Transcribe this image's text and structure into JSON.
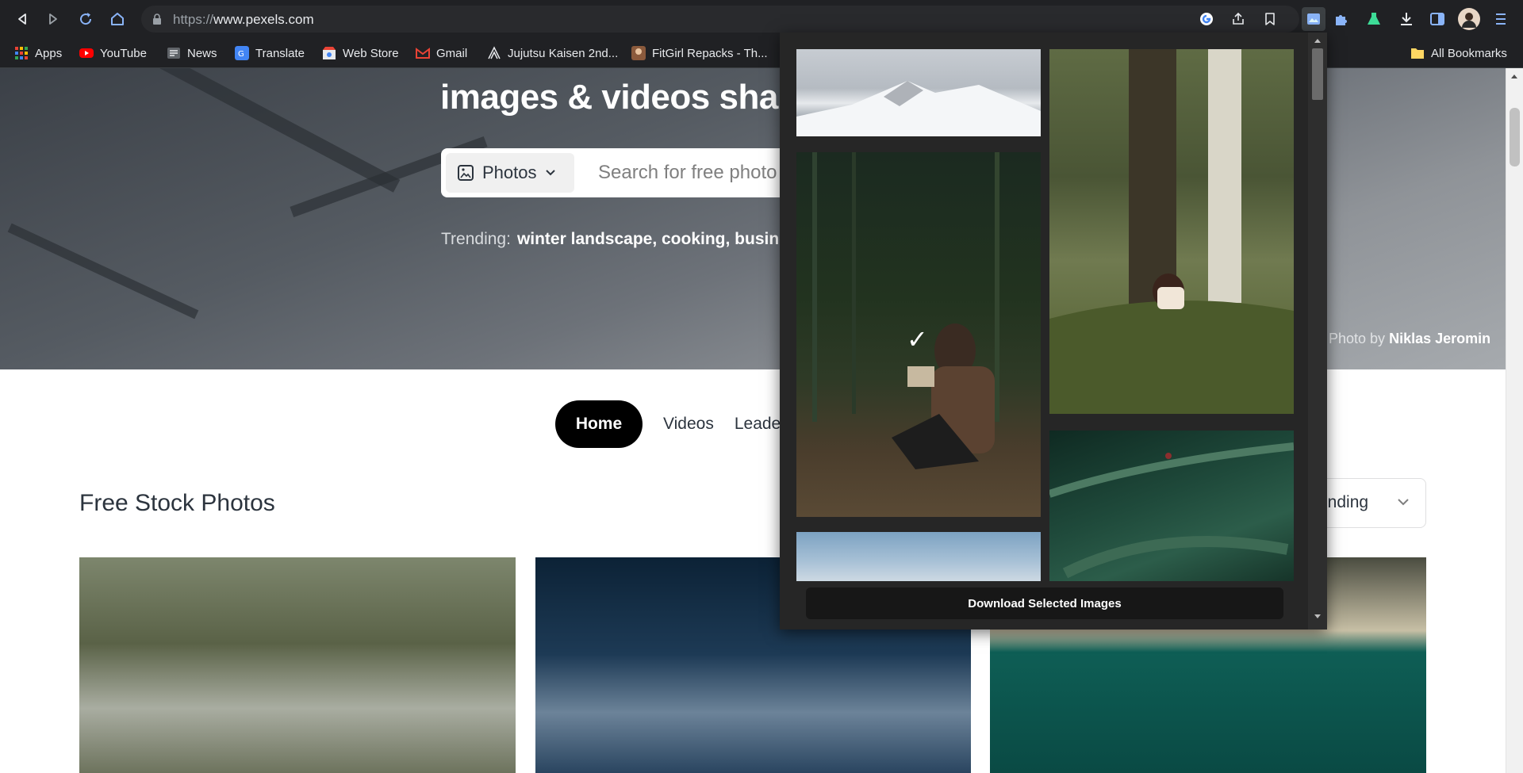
{
  "browser": {
    "url_scheme": "https://",
    "url_host": "www.pexels.com",
    "accent": "#8ab4f8"
  },
  "bookmarks": [
    {
      "label": "Apps",
      "icon": "apps-grid-icon",
      "color": "#ea4335"
    },
    {
      "label": "YouTube",
      "icon": "youtube-icon",
      "color": "#ff0000"
    },
    {
      "label": "News",
      "icon": "news-icon",
      "color": "#5f6368"
    },
    {
      "label": "Translate",
      "icon": "translate-icon",
      "color": "#4285f4"
    },
    {
      "label": "Web Store",
      "icon": "web-store-icon",
      "color": "#fbbc04"
    },
    {
      "label": "Gmail",
      "icon": "gmail-icon",
      "color": "#ea4335"
    },
    {
      "label": "Jujutsu Kaisen 2nd...",
      "icon": "jjk-icon",
      "color": "#9aa0a6"
    },
    {
      "label": "FitGirl Repacks - Th...",
      "icon": "fitgirl-icon",
      "color": "#a0522d"
    }
  ],
  "all_bookmarks": "All Bookmarks",
  "hero": {
    "title_line": "images & videos share",
    "search_type": "Photos",
    "search_placeholder": "Search for free photo",
    "trending_label": "Trending:",
    "trending_terms": "winter landscape, cooking, busine",
    "credit_prefix": "Photo by",
    "credit_name": "Niklas Jeromin"
  },
  "tabs": {
    "home": "Home",
    "videos": "Videos",
    "leaderboard": "Leade"
  },
  "section": {
    "title": "Free Stock Photos",
    "sort_label": "rending"
  },
  "popup": {
    "checkmark": "✓",
    "download_label": "Download Selected Images",
    "selected_count": 1
  }
}
